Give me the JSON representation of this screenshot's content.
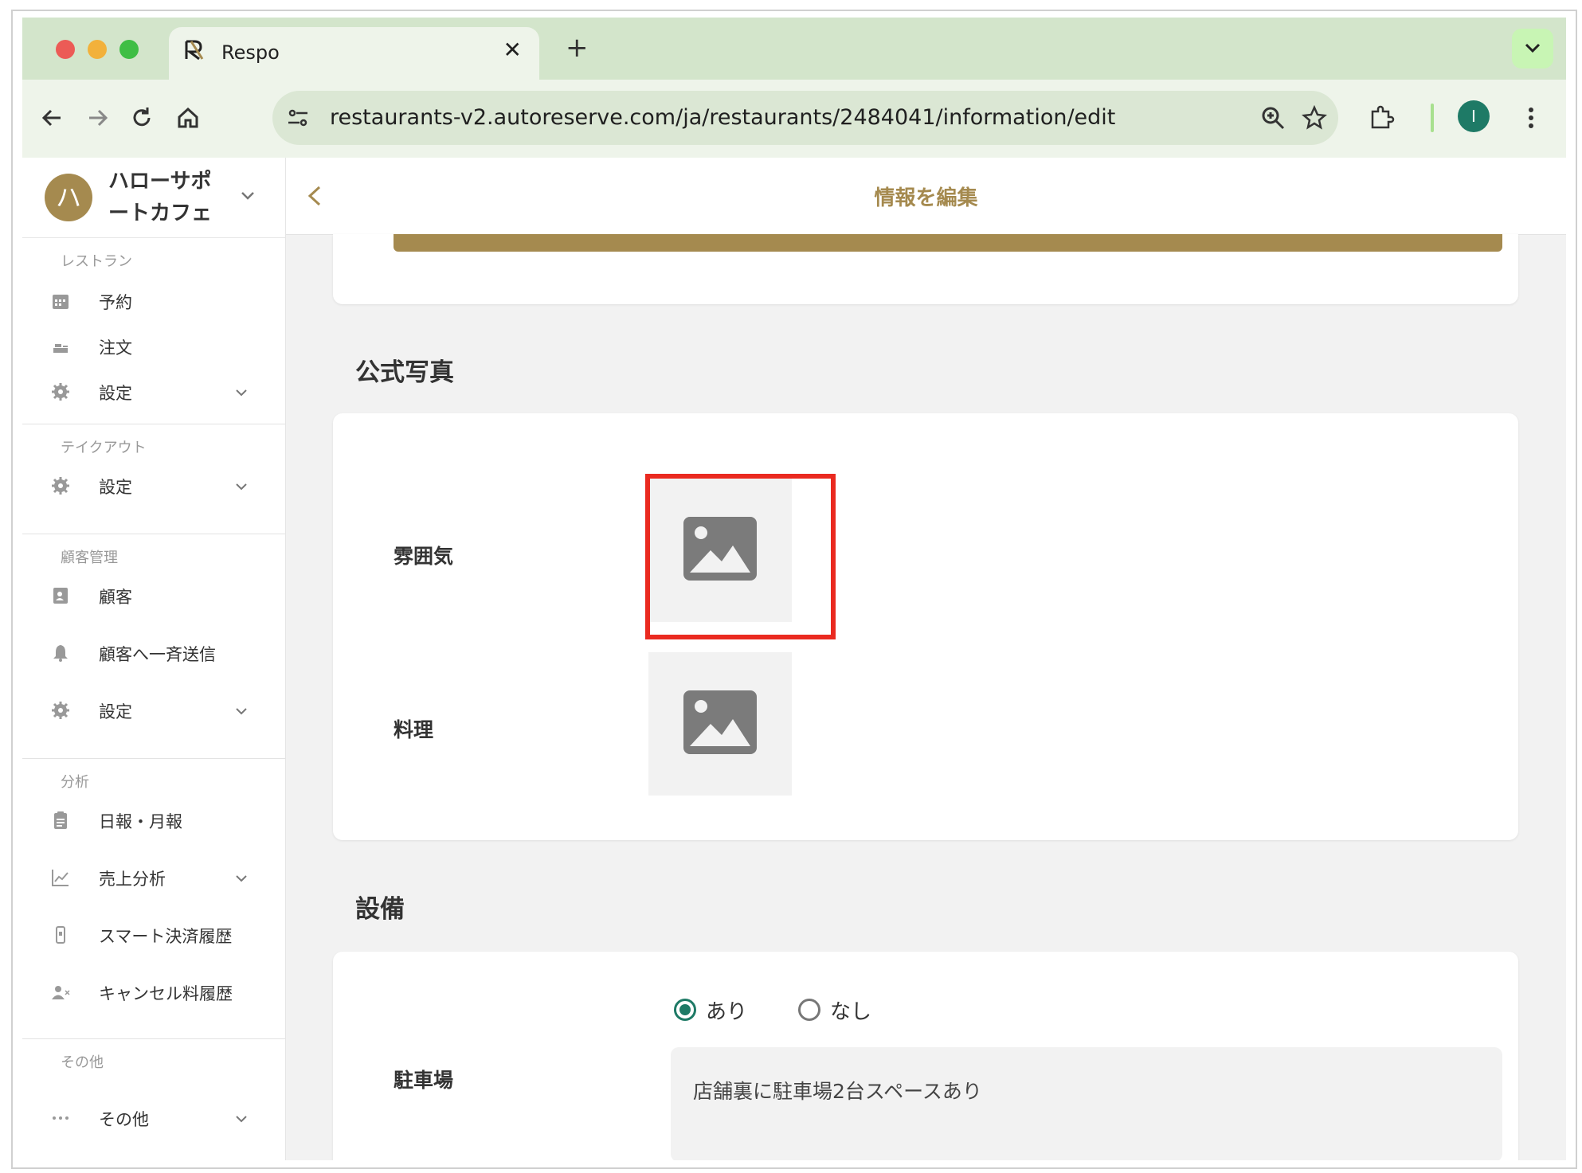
{
  "browser": {
    "tab_title": "Respo",
    "url": "restaurants-v2.autoreserve.com/ja/restaurants/2484041/information/edit",
    "profile_initial": "I",
    "colors": {
      "tabbar": "#d3e5cb",
      "accent_green": "#1e7a66"
    }
  },
  "sidebar": {
    "brand_initial": "ハ",
    "brand_name": "ハローサポートカフェ",
    "sections": [
      {
        "label": "レストラン",
        "items": [
          "予約",
          "注文",
          "設定"
        ]
      },
      {
        "label": "テイクアウト",
        "items": [
          "設定"
        ]
      },
      {
        "label": "顧客管理",
        "items": [
          "顧客",
          "顧客へ一斉送信",
          "設定"
        ]
      },
      {
        "label": "分析",
        "items": [
          "日報・月報",
          "売上分析",
          "スマート決済履歴",
          "キャンセル料履歴"
        ]
      },
      {
        "label": "その他",
        "items": [
          "その他"
        ]
      }
    ]
  },
  "header": {
    "title": "情報を編集"
  },
  "photos": {
    "heading": "公式写真",
    "rows": [
      {
        "label": "雰囲気"
      },
      {
        "label": "料理"
      }
    ]
  },
  "facilities": {
    "heading": "設備",
    "parking": {
      "label": "駐車場",
      "options": [
        "あり",
        "なし"
      ],
      "selected": "あり",
      "note": "店舗裏に駐車場2台スペースあり"
    }
  },
  "colors": {
    "gold": "#a58a4f",
    "highlight": "#ea2a20"
  }
}
